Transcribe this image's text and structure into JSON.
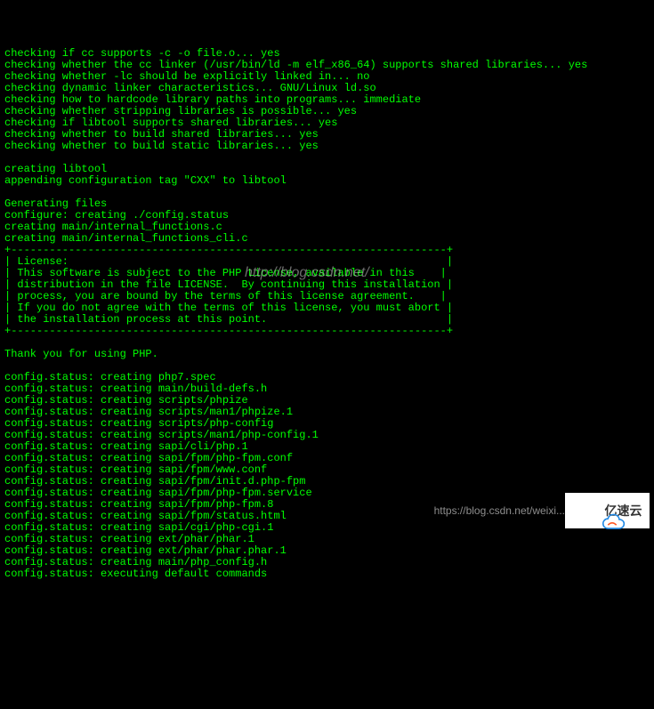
{
  "terminal": {
    "lines": [
      "checking if cc supports -c -o file.o... yes",
      "checking whether the cc linker (/usr/bin/ld -m elf_x86_64) supports shared libraries... yes",
      "checking whether -lc should be explicitly linked in... no",
      "checking dynamic linker characteristics... GNU/Linux ld.so",
      "checking how to hardcode library paths into programs... immediate",
      "checking whether stripping libraries is possible... yes",
      "checking if libtool supports shared libraries... yes",
      "checking whether to build shared libraries... yes",
      "checking whether to build static libraries... yes",
      "",
      "creating libtool",
      "appending configuration tag \"CXX\" to libtool",
      "",
      "Generating files",
      "configure: creating ./config.status",
      "creating main/internal_functions.c",
      "creating main/internal_functions_cli.c",
      "+--------------------------------------------------------------------+",
      "| License:                                                           |",
      "| This software is subject to the PHP License, available in this    |",
      "| distribution in the file LICENSE.  By continuing this installation |",
      "| process, you are bound by the terms of this license agreement.    |",
      "| If you do not agree with the terms of this license, you must abort |",
      "| the installation process at this point.                            |",
      "+--------------------------------------------------------------------+",
      "",
      "Thank you for using PHP.",
      "",
      "config.status: creating php7.spec",
      "config.status: creating main/build-defs.h",
      "config.status: creating scripts/phpize",
      "config.status: creating scripts/man1/phpize.1",
      "config.status: creating scripts/php-config",
      "config.status: creating scripts/man1/php-config.1",
      "config.status: creating sapi/cli/php.1",
      "config.status: creating sapi/fpm/php-fpm.conf",
      "config.status: creating sapi/fpm/www.conf",
      "config.status: creating sapi/fpm/init.d.php-fpm",
      "config.status: creating sapi/fpm/php-fpm.service",
      "config.status: creating sapi/fpm/php-fpm.8",
      "config.status: creating sapi/fpm/status.html",
      "config.status: creating sapi/cgi/php-cgi.1",
      "config.status: creating ext/phar/phar.1",
      "config.status: creating ext/phar/phar.phar.1",
      "config.status: creating main/php_config.h",
      "config.status: executing default commands"
    ]
  },
  "watermarks": {
    "center": "http://blog.csdn.net/",
    "bottom": "https://blog.csdn.net/weixi...",
    "logo_text": "亿速云"
  }
}
